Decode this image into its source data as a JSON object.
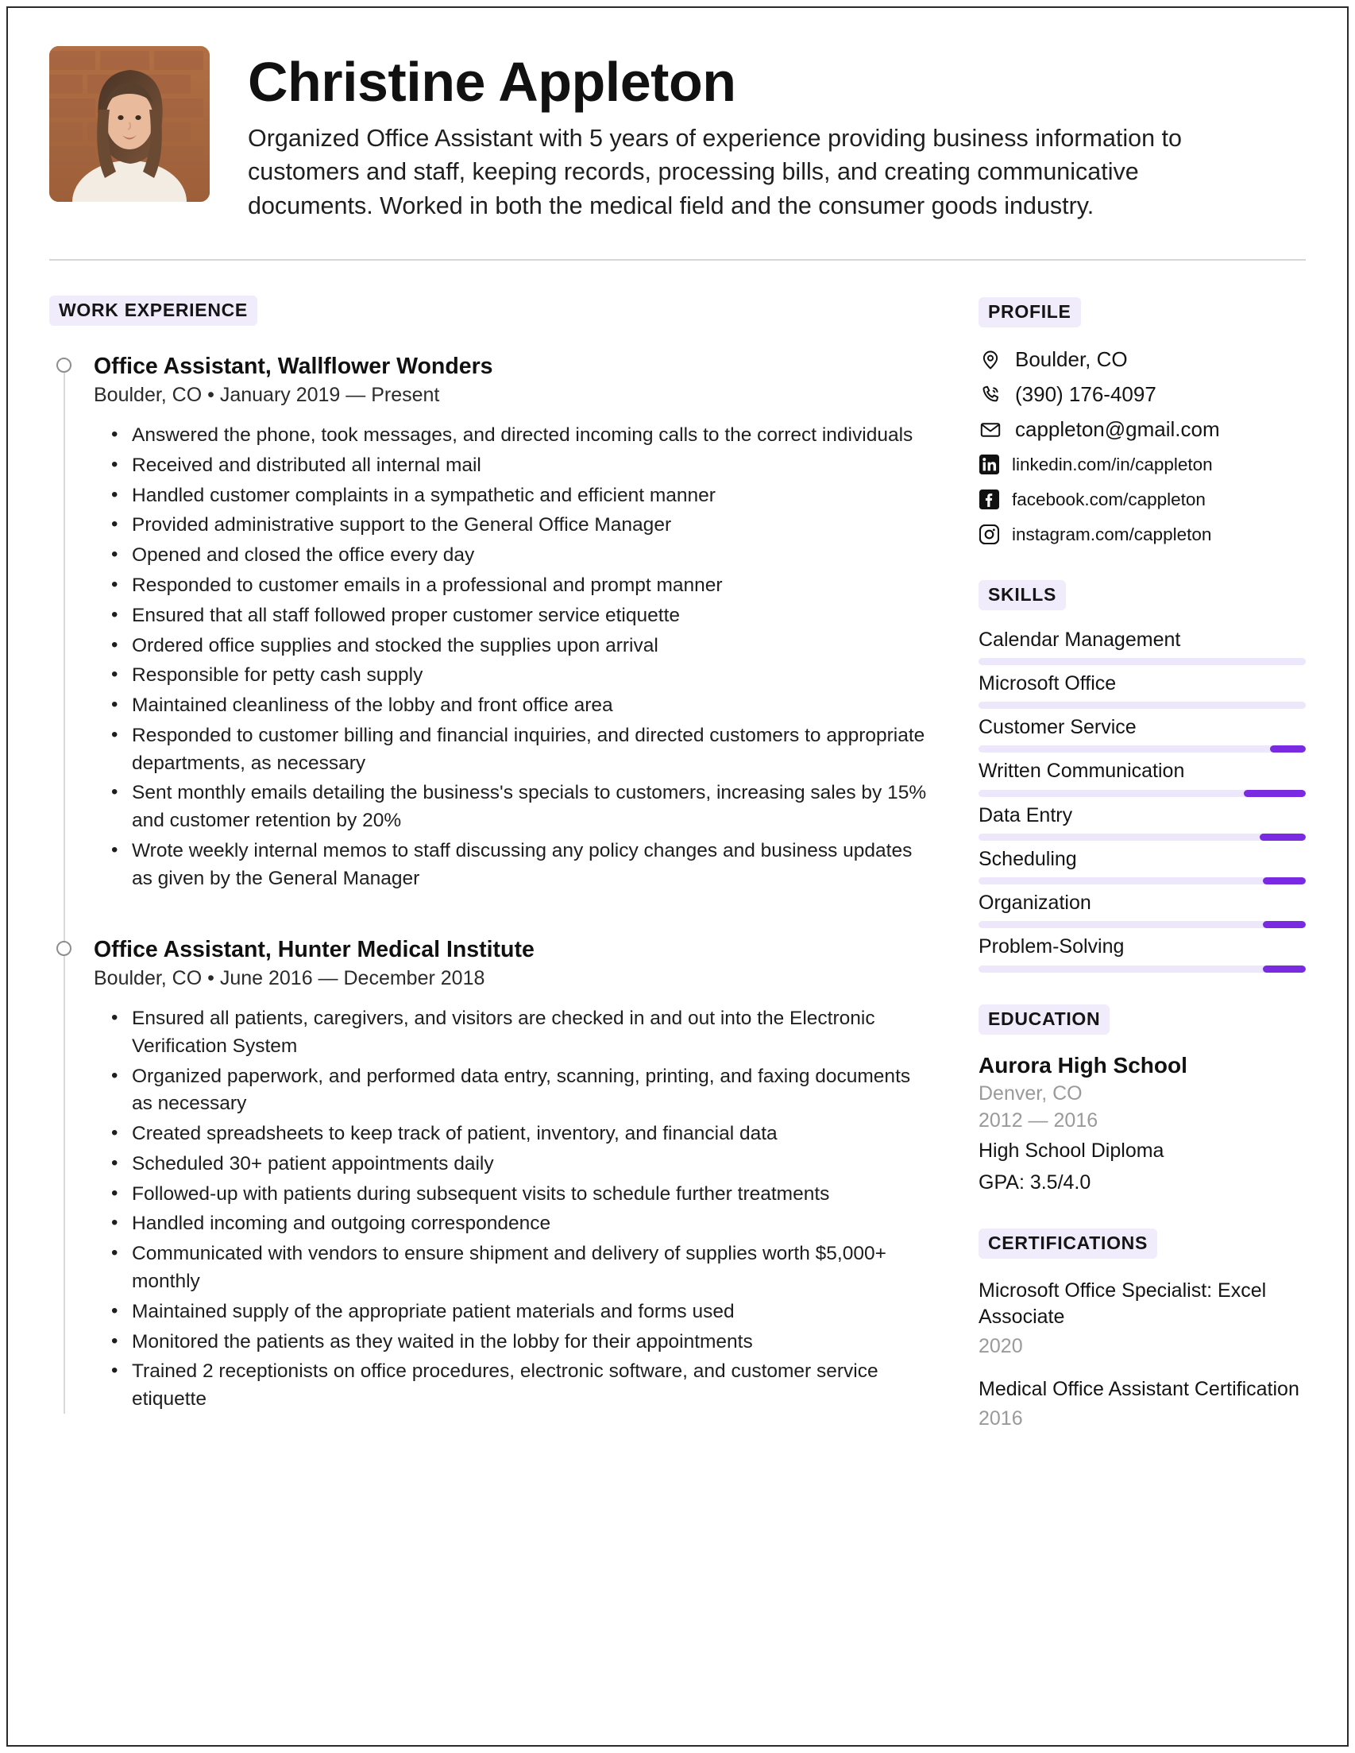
{
  "header": {
    "name": "Christine Appleton",
    "summary": "Organized Office Assistant with 5 years of experience providing business information to customers and staff, keeping records, processing bills, and creating communicative documents. Worked in both the medical field and the consumer goods industry.",
    "photo_alt": "headshot-photo"
  },
  "work": {
    "section_label": "WORK EXPERIENCE",
    "jobs": [
      {
        "title": "Office Assistant, Wallflower Wonders",
        "meta": "Boulder, CO • January 2019 — Present",
        "bullets": [
          "Answered the phone, took messages, and directed incoming calls to the correct individuals",
          "Received and distributed all internal mail",
          "Handled customer complaints in a sympathetic and efficient manner",
          "Provided administrative support to the General Office Manager",
          "Opened and closed the office every day",
          "Responded to customer emails in a professional and prompt manner",
          "Ensured that all staff followed proper customer service etiquette",
          "Ordered office supplies and stocked the supplies upon arrival",
          "Responsible for petty cash supply",
          "Maintained cleanliness of the lobby and front office area",
          "Responded to customer billing and financial inquiries, and directed customers to appropriate departments, as necessary",
          "Sent monthly emails detailing the business's specials to customers, increasing sales by 15% and customer retention by 20%",
          "Wrote weekly internal memos to staff discussing any policy changes and business updates as given by the General Manager"
        ]
      },
      {
        "title": "Office Assistant, Hunter Medical Institute",
        "meta": "Boulder, CO • June 2016 — December 2018",
        "bullets": [
          "Ensured all patients, caregivers, and visitors are checked in and out into the Electronic Verification System",
          "Organized paperwork, and performed data entry, scanning, printing, and faxing documents as necessary",
          "Created spreadsheets to keep track of patient, inventory, and financial data",
          "Scheduled 30+ patient appointments daily",
          "Followed-up with patients during subsequent visits to schedule further treatments",
          "Handled incoming and outgoing correspondence",
          "Communicated with vendors to ensure shipment and delivery of supplies worth $5,000+ monthly",
          "Maintained supply of the appropriate patient materials and forms used",
          "Monitored the patients as they waited in the lobby for their appointments",
          "Trained 2 receptionists on office procedures, electronic software, and customer service etiquette"
        ]
      }
    ]
  },
  "profile": {
    "section_label": "PROFILE",
    "contacts": [
      {
        "icon": "location-pin-icon",
        "text": "Boulder, CO",
        "style": "large"
      },
      {
        "icon": "phone-icon",
        "text": "(390) 176-4097",
        "style": "large"
      },
      {
        "icon": "email-envelope-icon",
        "text": "cappleton@gmail.com",
        "style": "large"
      },
      {
        "icon": "linkedin-icon",
        "text": "linkedin.com/in/cappleton",
        "style": "small"
      },
      {
        "icon": "facebook-icon",
        "text": "facebook.com/cappleton",
        "style": "small"
      },
      {
        "icon": "instagram-icon",
        "text": "instagram.com/cappleton",
        "style": "small"
      }
    ]
  },
  "skills": {
    "section_label": "SKILLS",
    "accent_color": "#7a2ae0",
    "track_color": "#ece7fa",
    "items": [
      {
        "name": "Calendar Management",
        "level": 0
      },
      {
        "name": "Microsoft Office",
        "level": 0
      },
      {
        "name": "Customer Service",
        "level": 11
      },
      {
        "name": "Written Communication",
        "level": 19
      },
      {
        "name": "Data Entry",
        "level": 14
      },
      {
        "name": "Scheduling",
        "level": 13
      },
      {
        "name": "Organization",
        "level": 13
      },
      {
        "name": "Problem-Solving",
        "level": 13
      }
    ]
  },
  "education": {
    "section_label": "EDUCATION",
    "school": "Aurora High School",
    "location": "Denver, CO",
    "years": "2012 — 2016",
    "degree": "High School Diploma",
    "gpa": "GPA: 3.5/4.0"
  },
  "certifications": {
    "section_label": "CERTIFICATIONS",
    "items": [
      {
        "name": "Microsoft Office Specialist: Excel Associate",
        "year": "2020"
      },
      {
        "name": "Medical Office Assistant Certification",
        "year": "2016"
      }
    ]
  }
}
